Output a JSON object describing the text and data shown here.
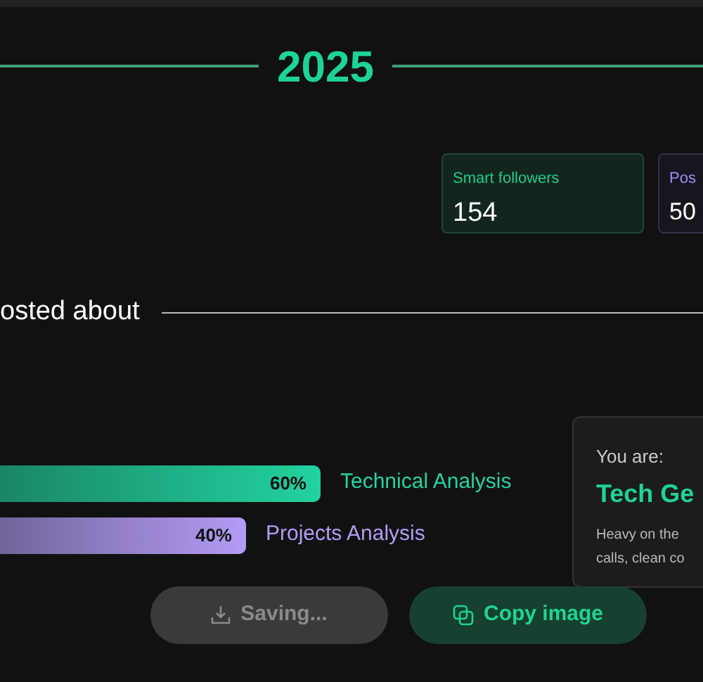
{
  "year": "2025",
  "stats": [
    {
      "label": "Smart followers",
      "value": "154",
      "color": "#22c98d"
    },
    {
      "label": "Pos",
      "value": "50",
      "color": "#a78bfa"
    }
  ],
  "section": {
    "title": "osted about"
  },
  "topics": [
    {
      "name": "Technical Analysis",
      "percent": "60%",
      "color": "#22d3a0"
    },
    {
      "name": "Projects Analysis",
      "percent": "40%",
      "color": "#b39cf5"
    }
  ],
  "persona": {
    "intro": "You are:",
    "title": "Tech Ge",
    "lines": [
      "Heavy on the",
      "calls, clean co"
    ]
  },
  "buttons": [
    {
      "kind": "save",
      "label": "Saving...",
      "disabled": true
    },
    {
      "kind": "copy",
      "label": "Copy image",
      "disabled": false
    }
  ]
}
